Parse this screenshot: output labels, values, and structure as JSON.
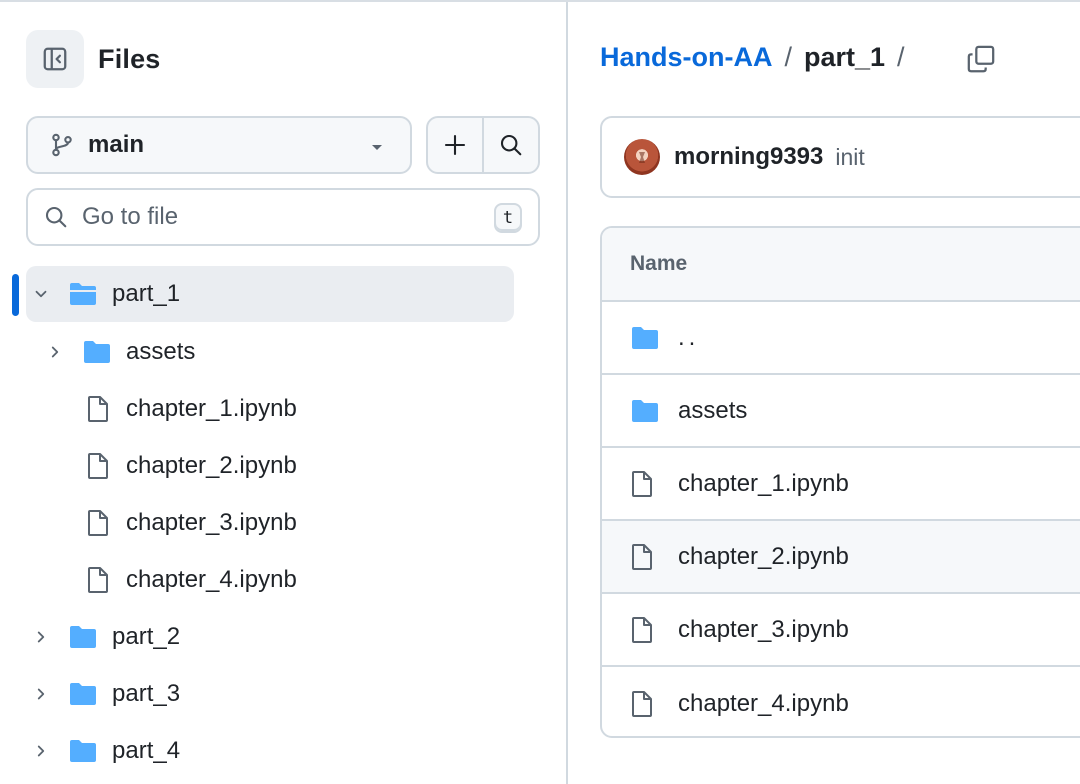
{
  "sidebar": {
    "title": "Files",
    "branch": "main",
    "search_placeholder": "Go to file",
    "search_shortcut": "t",
    "tree": [
      {
        "label": "part_1",
        "type": "folder",
        "open": true,
        "selected": true
      },
      {
        "label": "assets",
        "type": "folder"
      },
      {
        "label": "chapter_1.ipynb",
        "type": "file"
      },
      {
        "label": "chapter_2.ipynb",
        "type": "file"
      },
      {
        "label": "chapter_3.ipynb",
        "type": "file"
      },
      {
        "label": "chapter_4.ipynb",
        "type": "file"
      },
      {
        "label": "part_2",
        "type": "folder"
      },
      {
        "label": "part_3",
        "type": "folder"
      },
      {
        "label": "part_4",
        "type": "folder"
      }
    ]
  },
  "breadcrumb": {
    "repo": "Hands-on-AA",
    "separator": "/",
    "current": "part_1"
  },
  "commit": {
    "author": "morning9393",
    "message": "init"
  },
  "table": {
    "header": "Name",
    "rows": [
      {
        "label": "..",
        "type": "folder"
      },
      {
        "label": "assets",
        "type": "folder"
      },
      {
        "label": "chapter_1.ipynb",
        "type": "file"
      },
      {
        "label": "chapter_2.ipynb",
        "type": "file"
      },
      {
        "label": "chapter_3.ipynb",
        "type": "file"
      },
      {
        "label": "chapter_4.ipynb",
        "type": "file"
      }
    ]
  },
  "colors": {
    "accent": "#0969da",
    "folder": "#54aeff",
    "border": "#d1d9e0",
    "muted_text": "#59636e"
  }
}
